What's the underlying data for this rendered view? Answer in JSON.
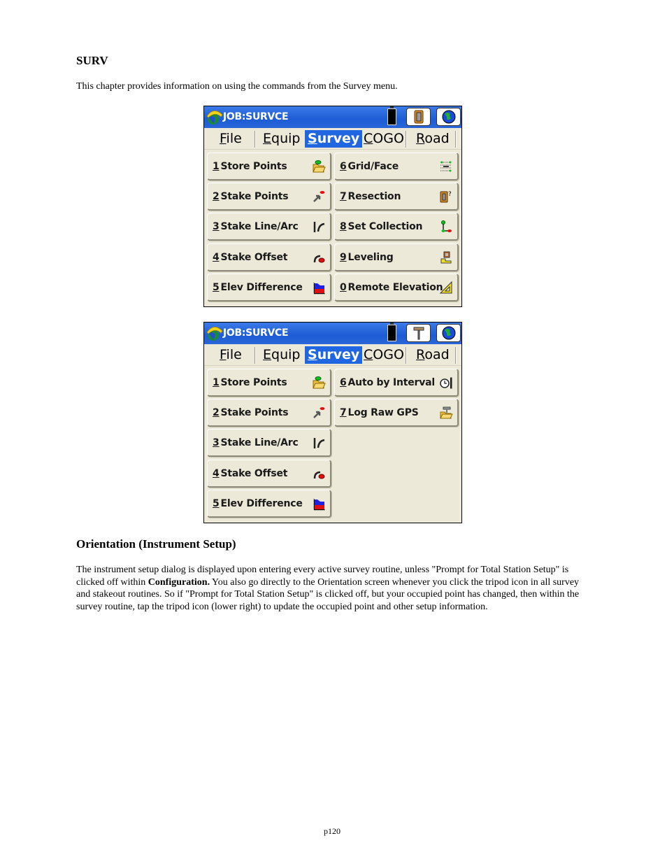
{
  "heading1": "SURV",
  "intro": "This chapter provides information on using the commands from the Survey menu.",
  "screens": [
    {
      "title": "JOB:SURVCE",
      "status_icons": [
        "battery-icon",
        "total-station-icon",
        "globe-icon"
      ],
      "menus": [
        {
          "key": "F",
          "rest": "ile",
          "active": false
        },
        {
          "key": "E",
          "rest": "quip",
          "active": false
        },
        {
          "key": "S",
          "rest": "urvey",
          "active": true
        },
        {
          "key": "C",
          "rest": "OGO",
          "active": false
        },
        {
          "key": "R",
          "rest": "oad",
          "active": false
        }
      ],
      "buttons": [
        {
          "key": "1",
          "label": "Store Points",
          "icon": "folder-point-icon"
        },
        {
          "key": "2",
          "label": "Stake Points",
          "icon": "stake-arrow-icon"
        },
        {
          "key": "3",
          "label": "Stake Line/Arc",
          "icon": "line-arc-icon"
        },
        {
          "key": "4",
          "label": "Stake Offset",
          "icon": "offset-icon"
        },
        {
          "key": "5",
          "label": "Elev Difference",
          "icon": "elev-difference-icon"
        },
        {
          "key": "6",
          "label": "Grid/Face",
          "icon": "grid-face-icon"
        },
        {
          "key": "7",
          "label": "Resection",
          "icon": "resection-icon"
        },
        {
          "key": "8",
          "label": "Set Collection",
          "icon": "set-collection-icon"
        },
        {
          "key": "9",
          "label": "Leveling",
          "icon": "leveling-icon"
        },
        {
          "key": "0",
          "label": "Remote Elevation",
          "icon": "triangle-icon"
        }
      ]
    },
    {
      "title": "JOB:SURVCE",
      "status_icons": [
        "battery-icon",
        "gps-receiver-icon",
        "globe-icon"
      ],
      "menus": [
        {
          "key": "F",
          "rest": "ile",
          "active": false
        },
        {
          "key": "E",
          "rest": "quip",
          "active": false
        },
        {
          "key": "S",
          "rest": "urvey",
          "active": true
        },
        {
          "key": "C",
          "rest": "OGO",
          "active": false
        },
        {
          "key": "R",
          "rest": "oad",
          "active": false
        }
      ],
      "buttons": [
        {
          "key": "1",
          "label": "Store Points",
          "icon": "folder-point-icon"
        },
        {
          "key": "2",
          "label": "Stake Points",
          "icon": "stake-arrow-icon"
        },
        {
          "key": "3",
          "label": "Stake Line/Arc",
          "icon": "line-arc-icon"
        },
        {
          "key": "4",
          "label": "Stake Offset",
          "icon": "offset-icon"
        },
        {
          "key": "5",
          "label": "Elev Difference",
          "icon": "elev-difference-icon"
        },
        {
          "key": "6",
          "label": "Auto by Interval",
          "icon": "clock-interval-icon"
        },
        {
          "key": "7",
          "label": "Log Raw GPS",
          "icon": "log-raw-gps-icon"
        }
      ]
    }
  ],
  "heading2": "Orientation (Instrument Setup)",
  "para2": {
    "part1": "The instrument setup dialog is displayed upon entering every active survey routine, unless \"Prompt for Total Station Setup\" is clicked off within ",
    "bold": "Configuration.",
    "part2": "  You also go directly to the Orientation screen whenever you click the tripod icon in all survey and stakeout routines.  So if \"Prompt for Total Station Setup\" is clicked off, but your occupied point has changed, then within the survey routine, tap the tripod icon (lower right) to update the occupied point and other setup information."
  },
  "page_number": "p120"
}
